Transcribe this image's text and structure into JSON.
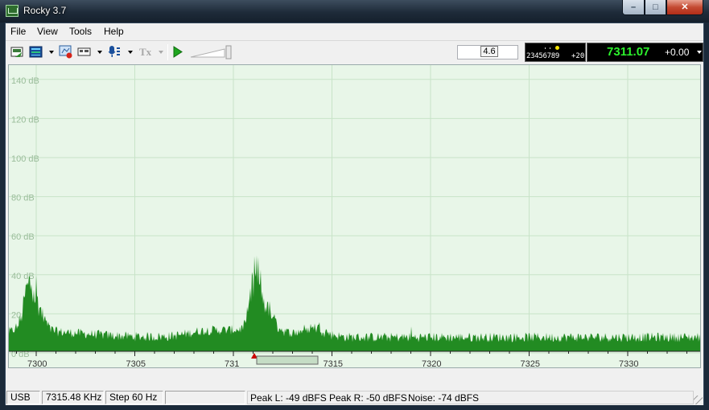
{
  "window": {
    "title": "Rocky 3.7"
  },
  "menu": [
    "File",
    "View",
    "Tools",
    "Help"
  ],
  "toolbar": {
    "rit_value": "4.6",
    "smeter_scale": "23456789",
    "smeter_plus": "+20",
    "frequency": "7311.07",
    "offset": "+0.00",
    "icons": [
      "config-icon",
      "waterfall-icon",
      "record-icon",
      "keyer-icon",
      "mic-icon",
      "tx-icon",
      "play-icon",
      "volume-slider-icon"
    ]
  },
  "spectrum": {
    "db_labels": [
      "140 dB",
      "120 dB",
      "100 dB",
      "80 dB",
      "60 dB",
      "40 dB",
      "20 dB",
      "0 dB"
    ],
    "freq_labels": [
      "7300",
      "7305",
      "731",
      "7315",
      "7320",
      "7325",
      "7330"
    ],
    "colors": {
      "background": "#e8f6e8",
      "grid": "#c8e3c8",
      "trace": "#228b22",
      "marker": "#cc0000"
    }
  },
  "status": {
    "mode": "USB",
    "frequency": "7315.48 KHz",
    "step": "Step 60 Hz",
    "peak_l": "Peak L: -49 dBFS",
    "peak_r": "Peak R: -50 dBFS",
    "noise": "Noise: -74 dBFS"
  }
}
